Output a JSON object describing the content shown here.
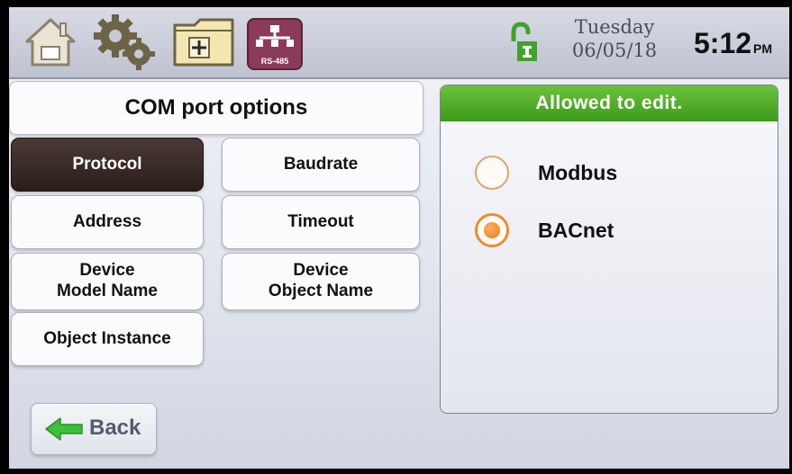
{
  "header": {
    "day": "Tuesday",
    "date": "06/05/18",
    "time": "5:12",
    "ampm": "PM",
    "rs485_label": "RS-485"
  },
  "page": {
    "title": "COM port options"
  },
  "menu": {
    "protocol": "Protocol",
    "baudrate": "Baudrate",
    "address": "Address",
    "timeout": "Timeout",
    "device_model_name": "Device\nModel Name",
    "device_object_name": "Device\nObject Name",
    "object_instance": "Object Instance"
  },
  "panel": {
    "header": "Allowed to edit.",
    "options": [
      {
        "label": "Modbus",
        "selected": false
      },
      {
        "label": "BACnet",
        "selected": true
      }
    ]
  },
  "back": {
    "label": "Back"
  },
  "colors": {
    "panel_header": "#4caf26",
    "radio_selected": "#f08a2a",
    "active_button": "#2a1e1a"
  }
}
